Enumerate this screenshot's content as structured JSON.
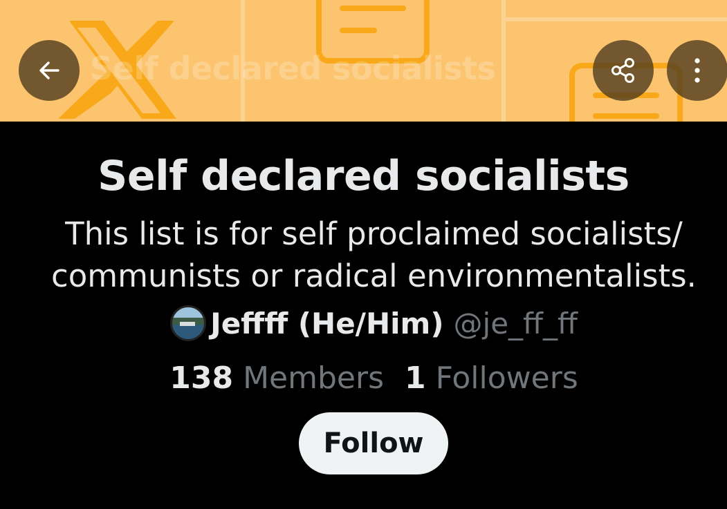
{
  "colors": {
    "banner_background": "#fcc46e",
    "banner_lines": "#f8a818",
    "text_primary": "#e7e9ea",
    "text_secondary": "#71767b",
    "follow_button": "#eff3f4",
    "page_background": "#000000"
  },
  "header": {
    "banner_ghost_title": "Self declared socialists",
    "back_icon": "arrow-left-icon",
    "share_icon": "share-icon",
    "more_icon": "more-vertical-icon"
  },
  "list": {
    "title": "Self declared socialists",
    "description_lines": [
      "This list is for self proclaimed socialists/",
      "communists or radical environmentalists."
    ],
    "owner": {
      "name": "Jeffff (He/Him)",
      "handle": "@je_ff_ff",
      "avatar_icon": "profile-avatar"
    },
    "stats": {
      "members_count": "138",
      "members_label": "Members",
      "followers_count": "1",
      "followers_label": "Followers"
    },
    "follow_label": "Follow"
  }
}
